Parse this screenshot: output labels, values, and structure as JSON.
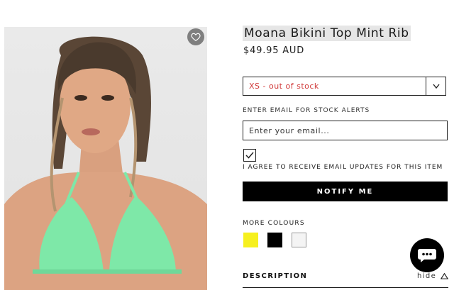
{
  "product": {
    "title": "Moana Bikini Top Mint Rib",
    "price": "$49.95 AUD",
    "image_alt": "model wearing mint ribbed triangle bikini top"
  },
  "size_select": {
    "selected": "XS - out of stock"
  },
  "stock_alert": {
    "label": "ENTER EMAIL FOR STOCK ALERTS",
    "email_placeholder": "Enter your email...",
    "email_value": "",
    "checkbox_checked": true,
    "agree_text": "I AGREE TO RECEIVE EMAIL UPDATES FOR THIS ITEM",
    "notify_label": "NOTIFY ME"
  },
  "colours": {
    "label": "MORE COLOURS",
    "swatches": [
      {
        "name": "yellow",
        "hex": "#f6f01f"
      },
      {
        "name": "black",
        "hex": "#000000"
      },
      {
        "name": "white",
        "hex": "#f4f4f4"
      }
    ]
  },
  "description": {
    "heading": "DESCRIPTION",
    "toggle": "hide"
  },
  "icons": {
    "favourite": "heart-icon",
    "select_arrow": "chevron-down-icon",
    "chat": "chat-bubble-icon",
    "collapse": "triangle-up-icon"
  }
}
